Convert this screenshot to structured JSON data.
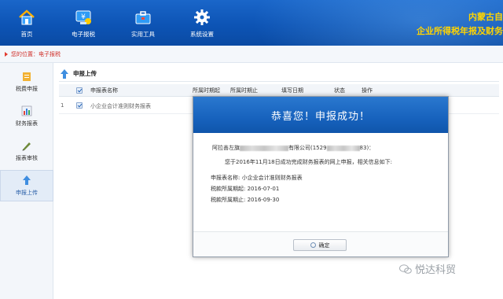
{
  "header": {
    "title_line1": "内蒙古自",
    "title_line2": "企业所得税年报及财务",
    "nav": [
      {
        "label": "首页",
        "icon": "home-icon"
      },
      {
        "label": "电子报税",
        "icon": "tax-screen-icon"
      },
      {
        "label": "实用工具",
        "icon": "toolbox-icon"
      },
      {
        "label": "系统设置",
        "icon": "gear-icon"
      }
    ],
    "colors": {
      "bar": "#0d54b5",
      "title": "#ffd400"
    }
  },
  "breadcrumb": {
    "text": "您的位置：电子报税"
  },
  "sidebar": {
    "items": [
      {
        "label": "税费申报",
        "icon": "declare-icon"
      },
      {
        "label": "财务报表",
        "icon": "chart-icon"
      },
      {
        "label": "报表审核",
        "icon": "review-icon"
      },
      {
        "label": "申报上传",
        "icon": "upload-icon",
        "active": true
      }
    ]
  },
  "main": {
    "panel_title": "申报上传",
    "columns": [
      "申报表名称",
      "所属时期起",
      "所属时期止",
      "填写日期",
      "状态",
      "操作"
    ],
    "rows": [
      {
        "index": "1",
        "name": "小企业会计准则财务报表"
      }
    ]
  },
  "modal": {
    "title": "恭喜您！申报成功！",
    "company_prefix": "阿拉善左旗",
    "company_suffix": "有限公司(1529",
    "company_end": "83)：",
    "message": "您于2016年11月18日成功完成财务报表的网上申报，相关信息如下:",
    "fields": [
      {
        "label": "申报表名称:",
        "value": "小企业会计准则财务报表"
      },
      {
        "label": "税款所属期起:",
        "value": "2016-07-01"
      },
      {
        "label": "税款所属期止:",
        "value": "2016-09-30"
      }
    ],
    "ok_label": "确定"
  },
  "watermark": {
    "text": "悦达科贸"
  }
}
